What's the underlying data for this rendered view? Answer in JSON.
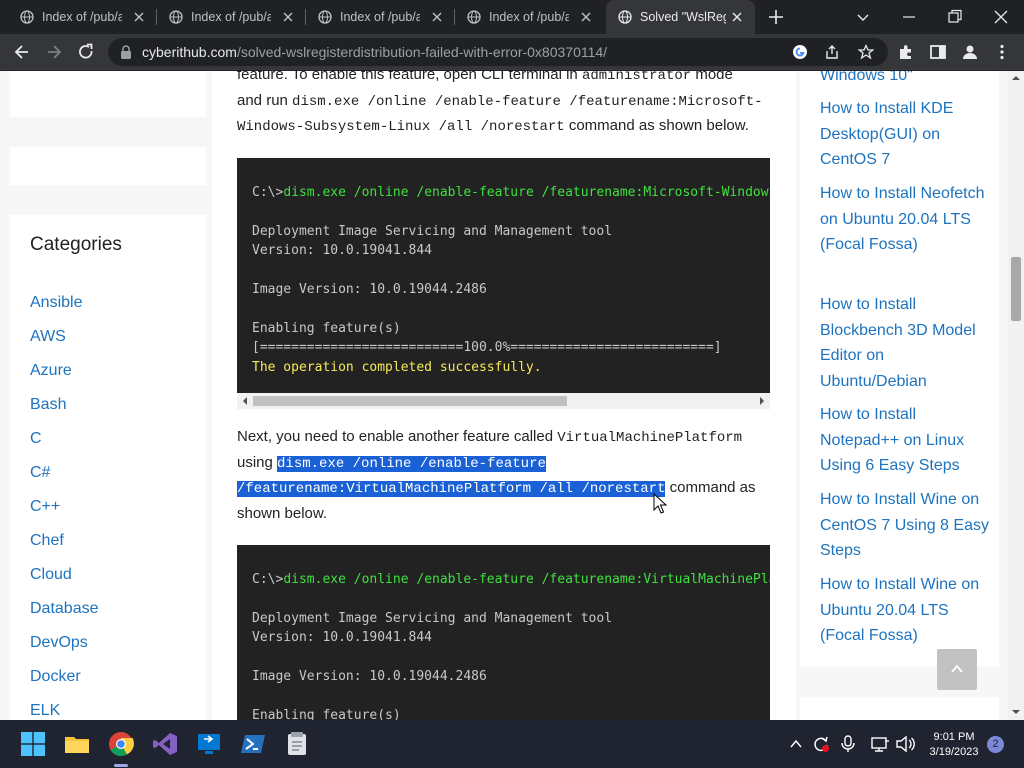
{
  "browser": {
    "tabs": [
      {
        "title": "Index of /pub/a",
        "active": false
      },
      {
        "title": "Index of /pub/a",
        "active": false
      },
      {
        "title": "Index of /pub/a",
        "active": false
      },
      {
        "title": "Index of /pub/a",
        "active": false
      },
      {
        "title": "Solved \"WslReg",
        "active": true
      }
    ],
    "url_domain": "cyberithub.com",
    "url_path": "/solved-wslregisterdistribution-failed-with-error-0x80370114/"
  },
  "sidebar_left": {
    "title": "Categories",
    "items": [
      "Ansible",
      "AWS",
      "Azure",
      "Bash",
      "C",
      "C#",
      "C++",
      "Chef",
      "Cloud",
      "Database",
      "DevOps",
      "Docker",
      "ELK"
    ]
  },
  "article": {
    "p1": {
      "line1_a": "feature. To enable this feature, open CLI terminal in ",
      "line1_code": "administrator",
      "line1_b": " mode",
      "line2_a": "and run ",
      "line2_code": "dism.exe /online /enable-feature /featurename:Microsoft-",
      "line3_code": "Windows-Subsystem-Linux /all /norestart",
      "line3_b": " command as shown below."
    },
    "terminal1": {
      "cmd_prompt": "C:\\>",
      "cmd": "dism.exe /online /enable-feature /featurename:Microsoft-Windows-Subsystem-Linux /all /norestart",
      "l2": "Deployment Image Servicing and Management tool",
      "l3": "Version: 10.0.19041.844",
      "l4": "Image Version: 10.0.19044.2486",
      "l5": "Enabling feature(s)",
      "l6": "[==========================100.0%==========================]",
      "l7": "The operation completed successfully."
    },
    "p2": {
      "line1_a": "Next, you need to enable another feature called ",
      "line1_code": "VirtualMachinePlatform",
      "line2_a": "using ",
      "line2_sel": "dism.exe /online /enable-feature ",
      "line3_sel": "/featurename:VirtualMachinePlatform /all /norestart",
      "line3_b": " command as",
      "line4": "shown below."
    },
    "terminal2": {
      "cmd_prompt": "C:\\>",
      "cmd": "dism.exe /online /enable-feature /featurename:VirtualMachinePlatform /all /norestart",
      "l2": "Deployment Image Servicing and Management tool",
      "l3": "Version: 10.0.19041.844",
      "l4": "Image Version: 10.0.19044.2486",
      "l5": "Enabling feature(s)"
    }
  },
  "sidebar_right": {
    "links": [
      "Windows 10\"",
      "How to Install KDE Desktop(GUI) on CentOS 7",
      "How to Install Neofetch on Ubuntu 20.04 LTS (Focal Fossa)",
      "How to Install Blockbench 3D Model Editor on Ubuntu/Debian",
      "How to Install Notepad++ on Linux Using 6 Easy Steps",
      "How to Install Wine on CentOS 7 Using 8 Easy Steps",
      "How to Install Wine on Ubuntu 20.04 LTS (Focal Fossa)"
    ]
  },
  "taskbar": {
    "time": "9:01 PM",
    "date": "3/19/2023",
    "notifications": "2"
  },
  "colors": {
    "link": "#1e73be",
    "selection": "#1a61d5",
    "terminal_bg": "#222222",
    "terminal_green": "#3fe03f",
    "terminal_yellow": "#f6e858"
  }
}
